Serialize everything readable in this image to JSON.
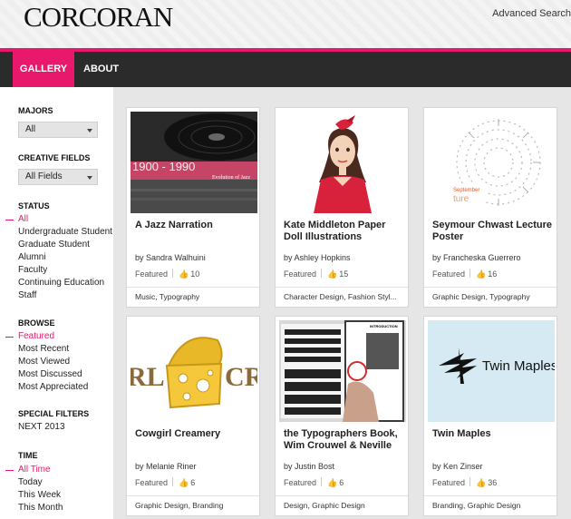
{
  "brand": {
    "logo": "CORCORAN",
    "accent": "#e8196c"
  },
  "header": {
    "advanced_search": "Advanced Search"
  },
  "nav": {
    "tabs": [
      {
        "label": "GALLERY"
      },
      {
        "label": "ABOUT"
      }
    ]
  },
  "sidebar": {
    "majors": {
      "heading": "MAJORS",
      "selected": "All"
    },
    "creative_fields": {
      "heading": "CREATIVE FIELDS",
      "selected": "All Fields"
    },
    "status": {
      "heading": "STATUS",
      "items": [
        "All",
        "Undergraduate Student",
        "Graduate Student",
        "Alumni",
        "Faculty",
        "Continuing Education",
        "Staff"
      ]
    },
    "browse": {
      "heading": "BROWSE",
      "items": [
        "Featured",
        "Most Recent",
        "Most Viewed",
        "Most Discussed",
        "Most Appreciated"
      ]
    },
    "special_filters": {
      "heading": "SPECIAL FILTERS",
      "items": [
        "NEXT 2013"
      ]
    },
    "time": {
      "heading": "TIME",
      "items": [
        "All Time",
        "Today",
        "This Week",
        "This Month"
      ]
    }
  },
  "cards": [
    {
      "title": "A Jazz Narration",
      "author": "by Sandra Walhuini",
      "featured": "Featured",
      "likes": "10",
      "tags": "Music, Typography",
      "img": {
        "line1": "1900 - 1990",
        "line2": "Evolution of Jazz"
      }
    },
    {
      "title": "Kate Middleton Paper Doll Illustrations",
      "author": "by Ashley Hopkins",
      "featured": "Featured",
      "likes": "15",
      "tags": "Character Design, Fashion Styl..."
    },
    {
      "title": "Seymour Chwast Lecture Poster",
      "author": "by Francheska Guerrero",
      "featured": "Featured",
      "likes": "16",
      "tags": "Graphic Design, Typography",
      "img": {
        "line1": "September",
        "line2": "ture"
      }
    },
    {
      "title": "Cowgirl Creamery",
      "author": "by Melanie Riner",
      "featured": "Featured",
      "likes": "6",
      "tags": "Graphic Design, Branding",
      "img": {
        "left": "RL",
        "right": "CR"
      }
    },
    {
      "title": "the Typographers Book, Wim Crouwel & Neville",
      "author": "by Justin Bost",
      "featured": "Featured",
      "likes": "6",
      "tags": "Design, Graphic Design",
      "img": {
        "heading": "INTRODUCTION"
      }
    },
    {
      "title": "Twin Maples",
      "author": "by Ken Zinser",
      "featured": "Featured",
      "likes": "36",
      "tags": "Branding, Graphic Design",
      "img": {
        "wordmark": "Twin Maples"
      }
    }
  ]
}
